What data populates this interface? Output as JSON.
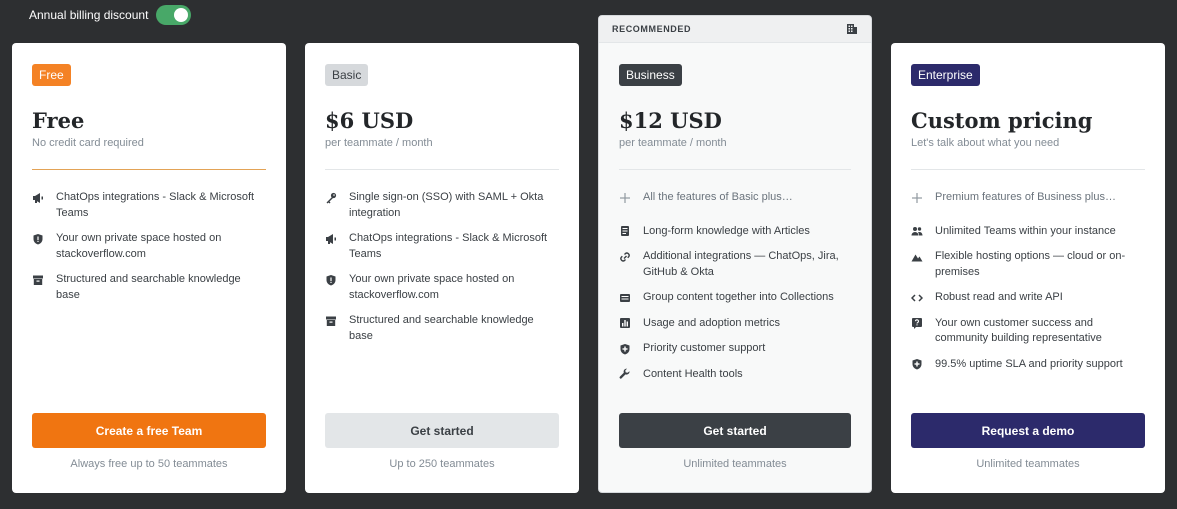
{
  "toggle": {
    "label": "Annual billing discount",
    "on": true
  },
  "plans": [
    {
      "badge": "Free",
      "price": "Free",
      "subtitle": "No credit card required",
      "features": [
        {
          "icon": "megaphone-icon",
          "text": "ChatOps integrations - Slack & Microsoft Teams"
        },
        {
          "icon": "shield-icon",
          "text": "Your own private space hosted on stackoverflow.com"
        },
        {
          "icon": "archive-icon",
          "text": "Structured and searchable knowledge base"
        }
      ],
      "button": "Create a free Team",
      "footnote": "Always free up to 50 teammates"
    },
    {
      "badge": "Basic",
      "price": "$6 USD",
      "subtitle": "per teammate / month",
      "features": [
        {
          "icon": "key-icon",
          "text": "Single sign-on (SSO) with SAML + Okta integration"
        },
        {
          "icon": "megaphone-icon",
          "text": "ChatOps integrations - Slack & Microsoft Teams"
        },
        {
          "icon": "shield-icon",
          "text": "Your own private space hosted on stackoverflow.com"
        },
        {
          "icon": "archive-icon",
          "text": "Structured and searchable knowledge base"
        }
      ],
      "button": "Get started",
      "footnote": "Up to 250 teammates"
    },
    {
      "recommended_label": "RECOMMENDED",
      "recommended_icon": "building-icon",
      "badge": "Business",
      "price": "$12 USD",
      "subtitle": "per teammate / month",
      "plus_line": "All the features of Basic plus…",
      "features": [
        {
          "icon": "document-icon",
          "text": "Long-form knowledge with Articles"
        },
        {
          "icon": "link-icon",
          "text": "Additional integrations — ChatOps, Jira, GitHub & Okta"
        },
        {
          "icon": "collection-icon",
          "text": "Group content together into Collections"
        },
        {
          "icon": "bar-chart-icon",
          "text": "Usage and adoption metrics"
        },
        {
          "icon": "shield-plus-icon",
          "text": "Priority customer support"
        },
        {
          "icon": "wrench-icon",
          "text": "Content Health tools"
        }
      ],
      "button": "Get started",
      "footnote": "Unlimited teammates"
    },
    {
      "badge": "Enterprise",
      "price": "Custom pricing",
      "subtitle": "Let's talk about what you need",
      "plus_line": "Premium features of Business plus…",
      "features": [
        {
          "icon": "users-icon",
          "text": "Unlimited Teams within your instance"
        },
        {
          "icon": "mountain-icon",
          "text": "Flexible hosting options — cloud or on-premises"
        },
        {
          "icon": "code-icon",
          "text": "Robust read and write API"
        },
        {
          "icon": "help-icon",
          "text": "Your own customer success and community building representative"
        },
        {
          "icon": "shield-plus-icon",
          "text": "99.5% uptime SLA and priority support"
        }
      ],
      "button": "Request a demo",
      "footnote": "Unlimited teammates"
    }
  ],
  "colors": {
    "page_bg": "#2d2f31",
    "toggle_on": "#48a868",
    "free_accent": "#f48225",
    "business_dark": "#3b4045",
    "enterprise_navy": "#2c2a6b"
  }
}
